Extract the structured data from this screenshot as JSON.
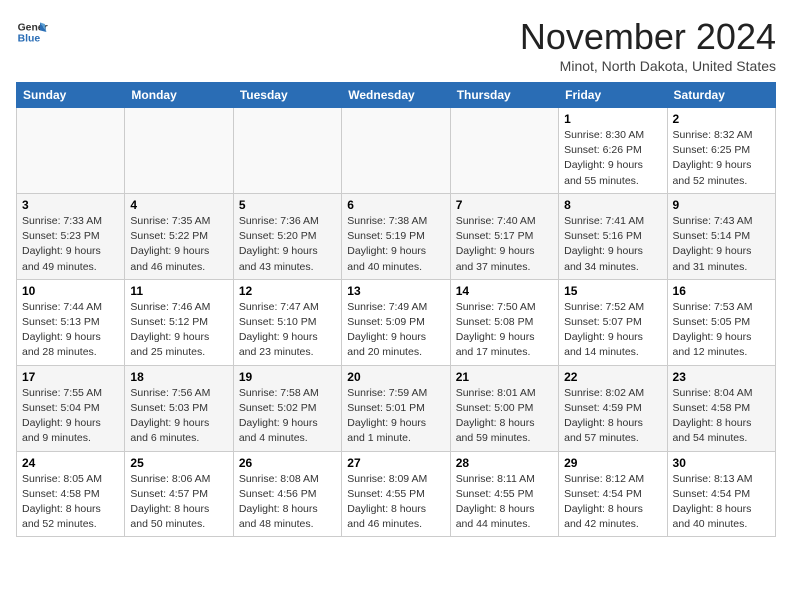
{
  "header": {
    "logo_general": "General",
    "logo_blue": "Blue",
    "month_title": "November 2024",
    "location": "Minot, North Dakota, United States"
  },
  "days_of_week": [
    "Sunday",
    "Monday",
    "Tuesday",
    "Wednesday",
    "Thursday",
    "Friday",
    "Saturday"
  ],
  "weeks": [
    [
      {
        "day": "",
        "info": ""
      },
      {
        "day": "",
        "info": ""
      },
      {
        "day": "",
        "info": ""
      },
      {
        "day": "",
        "info": ""
      },
      {
        "day": "",
        "info": ""
      },
      {
        "day": "1",
        "info": "Sunrise: 8:30 AM\nSunset: 6:26 PM\nDaylight: 9 hours and 55 minutes."
      },
      {
        "day": "2",
        "info": "Sunrise: 8:32 AM\nSunset: 6:25 PM\nDaylight: 9 hours and 52 minutes."
      }
    ],
    [
      {
        "day": "3",
        "info": "Sunrise: 7:33 AM\nSunset: 5:23 PM\nDaylight: 9 hours and 49 minutes."
      },
      {
        "day": "4",
        "info": "Sunrise: 7:35 AM\nSunset: 5:22 PM\nDaylight: 9 hours and 46 minutes."
      },
      {
        "day": "5",
        "info": "Sunrise: 7:36 AM\nSunset: 5:20 PM\nDaylight: 9 hours and 43 minutes."
      },
      {
        "day": "6",
        "info": "Sunrise: 7:38 AM\nSunset: 5:19 PM\nDaylight: 9 hours and 40 minutes."
      },
      {
        "day": "7",
        "info": "Sunrise: 7:40 AM\nSunset: 5:17 PM\nDaylight: 9 hours and 37 minutes."
      },
      {
        "day": "8",
        "info": "Sunrise: 7:41 AM\nSunset: 5:16 PM\nDaylight: 9 hours and 34 minutes."
      },
      {
        "day": "9",
        "info": "Sunrise: 7:43 AM\nSunset: 5:14 PM\nDaylight: 9 hours and 31 minutes."
      }
    ],
    [
      {
        "day": "10",
        "info": "Sunrise: 7:44 AM\nSunset: 5:13 PM\nDaylight: 9 hours and 28 minutes."
      },
      {
        "day": "11",
        "info": "Sunrise: 7:46 AM\nSunset: 5:12 PM\nDaylight: 9 hours and 25 minutes."
      },
      {
        "day": "12",
        "info": "Sunrise: 7:47 AM\nSunset: 5:10 PM\nDaylight: 9 hours and 23 minutes."
      },
      {
        "day": "13",
        "info": "Sunrise: 7:49 AM\nSunset: 5:09 PM\nDaylight: 9 hours and 20 minutes."
      },
      {
        "day": "14",
        "info": "Sunrise: 7:50 AM\nSunset: 5:08 PM\nDaylight: 9 hours and 17 minutes."
      },
      {
        "day": "15",
        "info": "Sunrise: 7:52 AM\nSunset: 5:07 PM\nDaylight: 9 hours and 14 minutes."
      },
      {
        "day": "16",
        "info": "Sunrise: 7:53 AM\nSunset: 5:05 PM\nDaylight: 9 hours and 12 minutes."
      }
    ],
    [
      {
        "day": "17",
        "info": "Sunrise: 7:55 AM\nSunset: 5:04 PM\nDaylight: 9 hours and 9 minutes."
      },
      {
        "day": "18",
        "info": "Sunrise: 7:56 AM\nSunset: 5:03 PM\nDaylight: 9 hours and 6 minutes."
      },
      {
        "day": "19",
        "info": "Sunrise: 7:58 AM\nSunset: 5:02 PM\nDaylight: 9 hours and 4 minutes."
      },
      {
        "day": "20",
        "info": "Sunrise: 7:59 AM\nSunset: 5:01 PM\nDaylight: 9 hours and 1 minute."
      },
      {
        "day": "21",
        "info": "Sunrise: 8:01 AM\nSunset: 5:00 PM\nDaylight: 8 hours and 59 minutes."
      },
      {
        "day": "22",
        "info": "Sunrise: 8:02 AM\nSunset: 4:59 PM\nDaylight: 8 hours and 57 minutes."
      },
      {
        "day": "23",
        "info": "Sunrise: 8:04 AM\nSunset: 4:58 PM\nDaylight: 8 hours and 54 minutes."
      }
    ],
    [
      {
        "day": "24",
        "info": "Sunrise: 8:05 AM\nSunset: 4:58 PM\nDaylight: 8 hours and 52 minutes."
      },
      {
        "day": "25",
        "info": "Sunrise: 8:06 AM\nSunset: 4:57 PM\nDaylight: 8 hours and 50 minutes."
      },
      {
        "day": "26",
        "info": "Sunrise: 8:08 AM\nSunset: 4:56 PM\nDaylight: 8 hours and 48 minutes."
      },
      {
        "day": "27",
        "info": "Sunrise: 8:09 AM\nSunset: 4:55 PM\nDaylight: 8 hours and 46 minutes."
      },
      {
        "day": "28",
        "info": "Sunrise: 8:11 AM\nSunset: 4:55 PM\nDaylight: 8 hours and 44 minutes."
      },
      {
        "day": "29",
        "info": "Sunrise: 8:12 AM\nSunset: 4:54 PM\nDaylight: 8 hours and 42 minutes."
      },
      {
        "day": "30",
        "info": "Sunrise: 8:13 AM\nSunset: 4:54 PM\nDaylight: 8 hours and 40 minutes."
      }
    ]
  ]
}
